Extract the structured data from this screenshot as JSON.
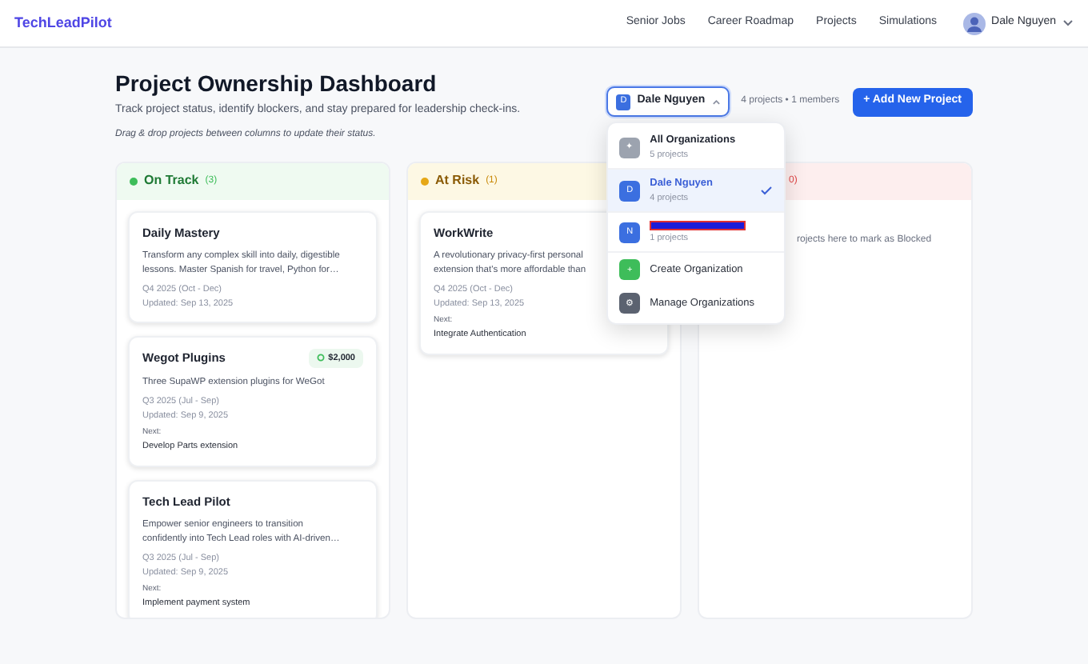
{
  "brand": "TechLeadPilot",
  "nav": [
    "Senior Jobs",
    "Career Roadmap",
    "Projects",
    "Simulations"
  ],
  "user": {
    "name": "Dale Nguyen"
  },
  "title": "Project Ownership Dashboard",
  "subtitle": "Track project status, identify blockers, and stay prepared for leadership check-ins.",
  "hint": "Drag & drop projects between columns to update their status.",
  "org_select": {
    "initial": "D",
    "name": "Dale Nguyen",
    "expanded": true
  },
  "org_stats": "4 projects • 1 members",
  "add_button": "+ Add New Project",
  "org_menu": [
    {
      "kind": "org",
      "initial": "✦",
      "name": "All Organizations",
      "sub": "5 projects",
      "color": "#9ca3af",
      "selected": false
    },
    {
      "kind": "org",
      "initial": "D",
      "name": "Dale Nguyen",
      "sub": "4 projects",
      "color": "#3b6fe0",
      "selected": true
    },
    {
      "kind": "redacted",
      "initial": "N",
      "sub": "1 projects",
      "color": "#3b6fe0",
      "selected": false
    },
    {
      "kind": "action",
      "initial": "+",
      "name": "Create Organization",
      "color": "#3ebd5a"
    },
    {
      "kind": "action",
      "initial": "⚙",
      "name": "Manage Organizations",
      "color": "#5b6270"
    }
  ],
  "columns": [
    {
      "kind": "green",
      "title": "On Track",
      "count": "(3)",
      "cards": [
        {
          "title": "Daily Mastery",
          "desc": [
            "Transform any complex skill into daily, digestible",
            "lessons. Master Spanish for travel, Python for…"
          ],
          "quarter": "Q4 2025 (Oct - Dec)",
          "updated": "Updated: Sep 13, 2025"
        },
        {
          "title": "Wegot Plugins",
          "badge": "$2,000",
          "desc": [
            "Three SupaWP extension plugins for WeGot"
          ],
          "quarter": "Q3 2025 (Jul - Sep)",
          "updated": "Updated: Sep 9, 2025",
          "next_label": "Next:",
          "next": "Develop Parts extension"
        },
        {
          "title": "Tech Lead Pilot",
          "desc": [
            "Empower senior engineers to transition",
            "confidently into Tech Lead roles with AI-driven…"
          ],
          "quarter": "Q3 2025 (Jul - Sep)",
          "updated": "Updated: Sep 9, 2025",
          "next_label": "Next:",
          "next": "Implement payment system"
        }
      ]
    },
    {
      "kind": "amber",
      "title": "At Risk",
      "count": "(1)",
      "cards": [
        {
          "title": "WorkWrite",
          "desc": [
            "A revolutionary privacy-first personal",
            "extension that's more affordable than"
          ],
          "quarter": "Q4 2025 (Oct - Dec)",
          "updated": "Updated: Sep 13, 2025",
          "next_label": "Next:",
          "next": "Integrate Authentication"
        }
      ]
    },
    {
      "kind": "red",
      "count": "0)",
      "empty": "rojects here to mark as Blocked"
    }
  ]
}
